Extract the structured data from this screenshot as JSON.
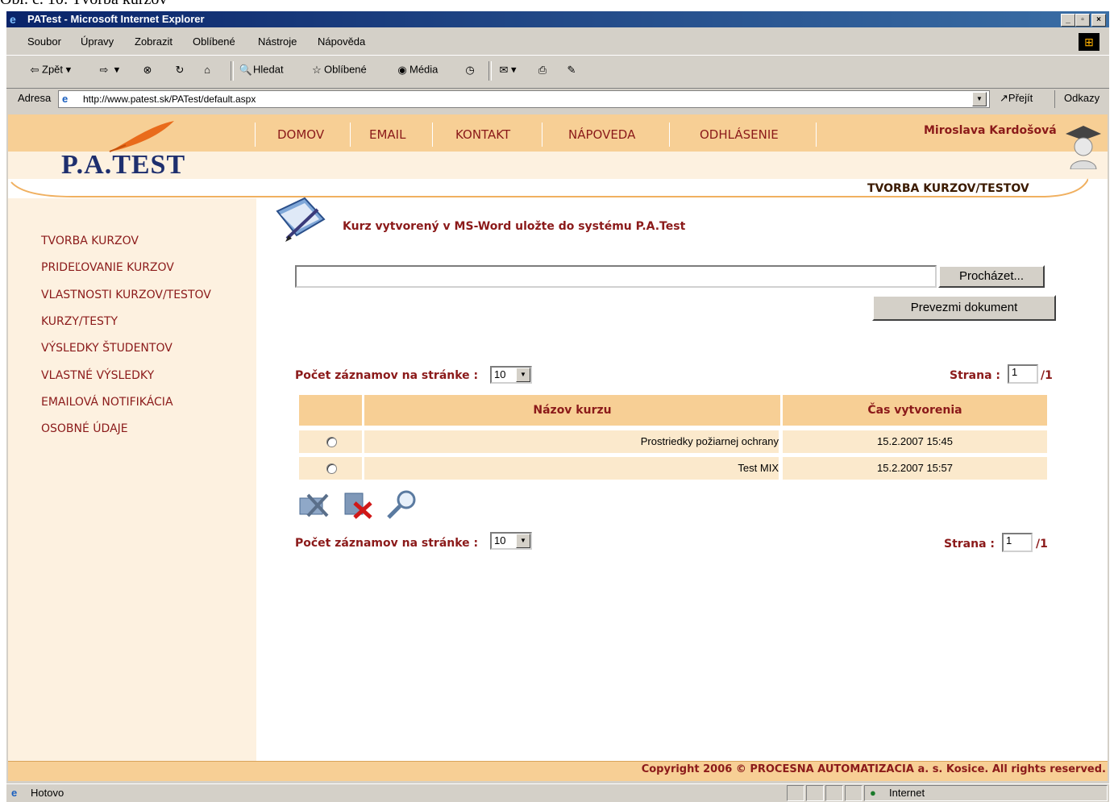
{
  "caption": "Obr. č. 10: Tvorba kurzov",
  "window": {
    "title": "PATest - Microsoft Internet Explorer",
    "buttons": [
      "_",
      "▫",
      "×"
    ]
  },
  "menu": [
    "Soubor",
    "Úpravy",
    "Zobrazit",
    "Oblíbené",
    "Nástroje",
    "Nápověda"
  ],
  "toolbar": {
    "back": "Zpět",
    "search": "Hledat",
    "favorites": "Oblíbené",
    "media": "Média"
  },
  "address": {
    "label": "Adresa",
    "url": "http://www.patest.sk/PATest/default.aspx",
    "go": "Přejít",
    "links": "Odkazy"
  },
  "site": {
    "logo": "P.A.TEST",
    "nav": [
      "DOMOV",
      "EMAIL",
      "KONTAKT",
      "NÁPOVEDA",
      "ODHLÁSENIE"
    ],
    "user": "Miroslava Kardošová",
    "breadcrumb": "TVORBA KURZOV/TESTOV"
  },
  "sidebar": [
    "TVORBA KURZOV",
    "PRIDEĽOVANIE KURZOV",
    "VLASTNOSTI KURZOV/TESTOV",
    "KURZY/TESTY",
    "VÝSLEDKY ŠTUDENTOV",
    "VLASTNÉ VÝSLEDKY",
    "EMAILOVÁ NOTIFIKÁCIA",
    "OSOBNÉ ÚDAJE"
  ],
  "upload": {
    "title": "Kurz vytvorený v MS-Word uložte do systému P.A.Test",
    "file_value": "",
    "browse": "Procházet...",
    "submit": "Prevezmi dokument"
  },
  "paging": {
    "records_label": "Počet záznamov na stránke :",
    "records_value": "10",
    "page_label": "Strana :",
    "page_value": "1",
    "page_total": "/1"
  },
  "table": {
    "headers": [
      "",
      "Názov kurzu",
      "Čas vytvorenia"
    ],
    "rows": [
      {
        "name": "Prostriedky požiarnej ochrany",
        "time": "15.2.2007 15:45"
      },
      {
        "name": "Test MIX",
        "time": "15.2.2007 15:57"
      }
    ]
  },
  "actions": [
    "edit-course-icon",
    "delete-course-icon",
    "view-course-icon"
  ],
  "footer": {
    "copyright": "Copyright 2006 © PROCESNA AUTOMATIZACIA a. s. Kosice. All rights reserved."
  },
  "status": {
    "text": "Hotovo",
    "zone": "Internet"
  }
}
